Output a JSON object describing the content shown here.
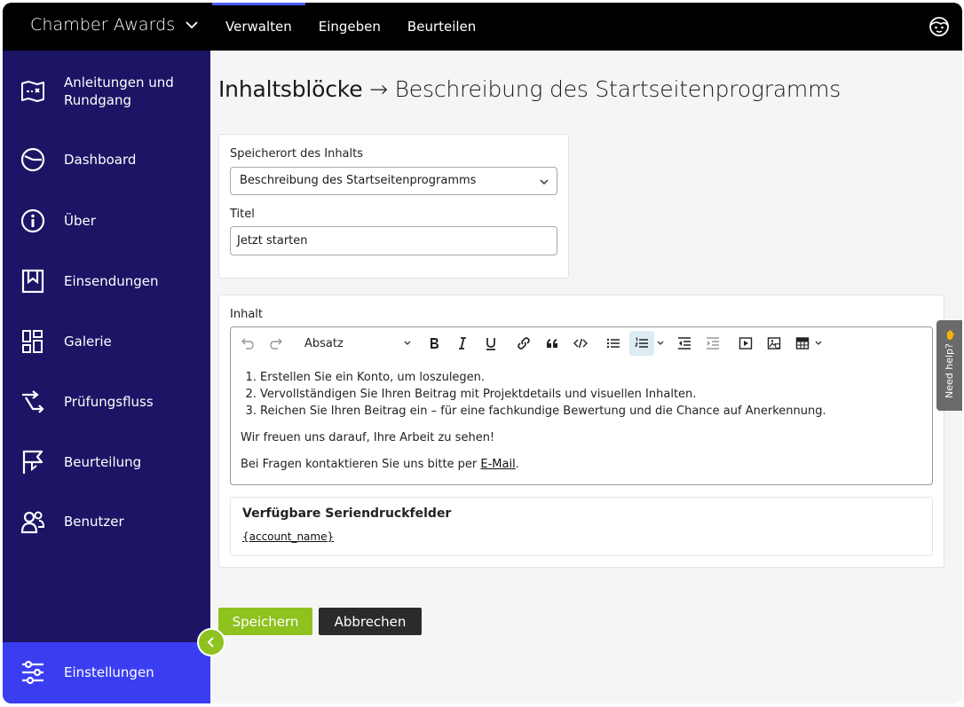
{
  "app": {
    "title": "Chamber Awards"
  },
  "topnav": {
    "items": [
      {
        "label": "Verwalten",
        "active": true
      },
      {
        "label": "Eingeben",
        "active": false
      },
      {
        "label": "Beurteilen",
        "active": false
      }
    ]
  },
  "sidebar": {
    "items": [
      {
        "label": "Anleitungen und Rundgang",
        "icon": "map-icon"
      },
      {
        "label": "Dashboard",
        "icon": "gauge-icon"
      },
      {
        "label": "Über",
        "icon": "info-icon"
      },
      {
        "label": "Einsendungen",
        "icon": "bookmark-icon"
      },
      {
        "label": "Galerie",
        "icon": "grid-icon"
      },
      {
        "label": "Prüfungsfluss",
        "icon": "flow-icon"
      },
      {
        "label": "Beurteilung",
        "icon": "flag-icon"
      },
      {
        "label": "Benutzer",
        "icon": "users-icon"
      }
    ],
    "bottom": {
      "label": "Einstellungen",
      "icon": "sliders-icon"
    }
  },
  "page": {
    "title_main": "Inhaltsblöcke",
    "title_arrow": " → ",
    "title_sub": "Beschreibung des Startseitenprogramms"
  },
  "form": {
    "location_label": "Speicherort des Inhalts",
    "location_value": "Beschreibung des Startseitenprogramms",
    "title_label": "Titel",
    "title_value": "Jetzt starten",
    "content_label": "Inhalt"
  },
  "editor": {
    "block_format": "Absatz",
    "list": [
      "Erstellen Sie ein Konto, um loszulegen.",
      "Vervollständigen Sie Ihren Beitrag mit Projektdetails und visuellen Inhalten.",
      "Reichen Sie Ihren Beitrag ein – für eine fachkundige Bewertung und die Chance auf Anerkennung."
    ],
    "para1": "Wir freuen uns darauf, Ihre Arbeit zu sehen!",
    "para2_prefix": "Bei Fragen kontaktieren Sie uns bitte per ",
    "para2_link": "E-Mail",
    "para2_suffix": "."
  },
  "merge_fields": {
    "title": "Verfügbare Seriendruckfelder",
    "fields": [
      "{account_name}"
    ]
  },
  "actions": {
    "save": "Speichern",
    "cancel": "Abbrechen"
  },
  "help": {
    "label": "Need help?"
  },
  "colors": {
    "sidebar_bg": "#1c1464",
    "sidebar_active": "#3b3ef0",
    "accent_green": "#8dc21f",
    "topbar_bg": "#000000"
  }
}
